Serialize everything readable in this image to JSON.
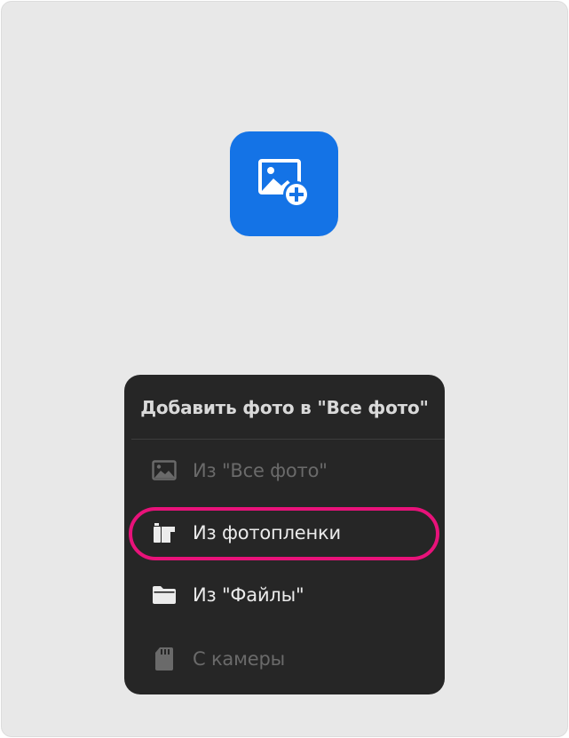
{
  "colors": {
    "app_icon_bg": "#1473e6",
    "menu_bg": "#262626",
    "highlight": "#e8127a"
  },
  "app_icon": {
    "icon": "add-image-icon"
  },
  "menu": {
    "title": "Добавить фото в \"Все фото\"",
    "items": [
      {
        "label": "Из \"Все фото\"",
        "icon": "gallery-icon",
        "enabled": false
      },
      {
        "label": "Из фотопленки",
        "icon": "camera-roll-icon",
        "enabled": true,
        "highlighted": true
      },
      {
        "label": "Из \"Файлы\"",
        "icon": "folder-icon",
        "enabled": true
      },
      {
        "label": "С камеры",
        "icon": "sd-card-icon",
        "enabled": false
      }
    ]
  }
}
